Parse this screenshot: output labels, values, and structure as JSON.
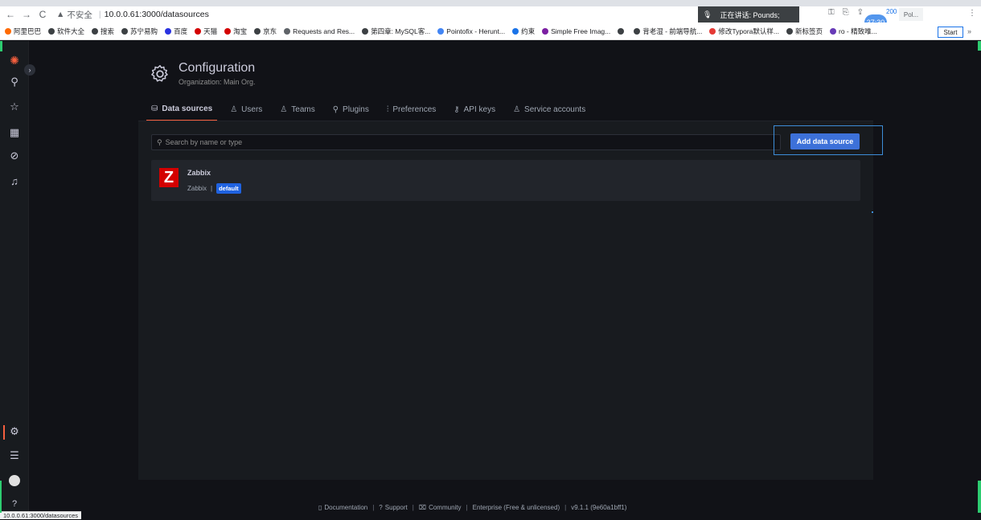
{
  "browser": {
    "address_insecure": "不安全",
    "address_url": "10.0.0.61:3000/datasources",
    "speaking_label": "正在讲话: Pounds;",
    "timer": "37:30",
    "popup_label": "Pol...",
    "counter": "200",
    "start_label": "Start",
    "bookmarks": [
      {
        "label": "阿里巴巴",
        "color": "#ff6a00"
      },
      {
        "label": "软件大全",
        "color": "#3c4043"
      },
      {
        "label": "搜索",
        "color": "#3c4043"
      },
      {
        "label": "苏宁易购",
        "color": "#3c4043"
      },
      {
        "label": "百度",
        "color": "#2932e1"
      },
      {
        "label": "天猫",
        "color": "#d40000"
      },
      {
        "label": "淘宝",
        "color": "#d40000"
      },
      {
        "label": "京东",
        "color": "#3c4043"
      },
      {
        "label": "Requests and Res...",
        "color": "#5f6368"
      },
      {
        "label": "第四章: MySQL客...",
        "color": "#3c4043"
      },
      {
        "label": "Pointofix - Herunt...",
        "color": "#4285f4"
      },
      {
        "label": "约束",
        "color": "#1a73e8"
      },
      {
        "label": "Simple Free Imag...",
        "color": "#7b1fa2"
      },
      {
        "label": "",
        "color": "#3c4043"
      },
      {
        "label": "背老湿 - 前端导航...",
        "color": "#3c4043"
      },
      {
        "label": "修改Typora默认样...",
        "color": "#e53935"
      },
      {
        "label": "新标签页",
        "color": "#3c4043"
      },
      {
        "label": "ro - 精致唯...",
        "color": "#673ab7"
      }
    ],
    "status_url": "10.0.0.61:3000/datasources"
  },
  "page": {
    "title": "Configuration",
    "subtitle": "Organization: Main Org."
  },
  "tabs": [
    {
      "label": "Data sources",
      "icon": "database-icon",
      "glyph": "⛁",
      "active": true
    },
    {
      "label": "Users",
      "icon": "user-icon",
      "glyph": "♙",
      "active": false
    },
    {
      "label": "Teams",
      "icon": "users-icon",
      "glyph": "♙",
      "active": false
    },
    {
      "label": "Plugins",
      "icon": "plug-icon",
      "glyph": "⚲",
      "active": false
    },
    {
      "label": "Preferences",
      "icon": "sliders-icon",
      "glyph": "⫶",
      "active": false
    },
    {
      "label": "API keys",
      "icon": "key-icon",
      "glyph": "⚷",
      "active": false
    },
    {
      "label": "Service accounts",
      "icon": "user-cog-icon",
      "glyph": "♙",
      "active": false
    }
  ],
  "search": {
    "placeholder": "Search by name or type"
  },
  "add_button": "Add data source",
  "datasource": {
    "logo_letter": "Z",
    "name": "Zabbix",
    "type": "Zabbix",
    "separator": "|",
    "badge": "default"
  },
  "footer": {
    "documentation": "Documentation",
    "support": "Support",
    "community": "Community",
    "edition": "Enterprise (Free & unlicensed)",
    "version": "v9.1.1 (9e60a1bff1)",
    "separator": "|"
  },
  "colors": {
    "accent": "#f55f3e",
    "primary_button": "#3d71d9",
    "badge": "#1f62e0",
    "zabbix_red": "#d40000"
  }
}
